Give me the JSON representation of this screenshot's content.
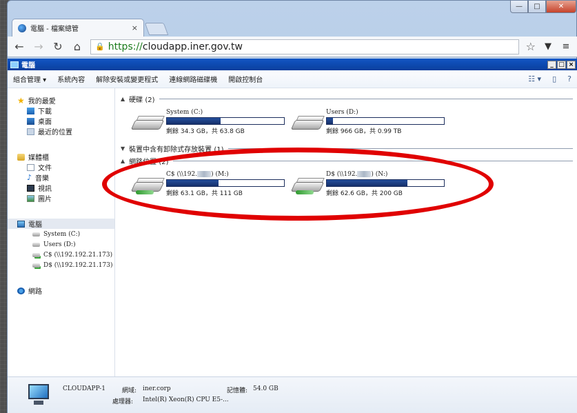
{
  "browser": {
    "tab_title": "電腦 - 檔案總管",
    "tab_close": "×",
    "url_scheme": "https://",
    "url_host": "cloudapp.iner.gov.tw",
    "window_controls": {
      "minimize": "—",
      "maximize": "□",
      "close": "✕"
    }
  },
  "explorer": {
    "title": "電腦",
    "window_controls": {
      "minimize": "_",
      "maximize": "□",
      "close": "×"
    },
    "commands": [
      {
        "label": "組合管理 ▾"
      },
      {
        "label": "系統內容"
      },
      {
        "label": "解除安裝或變更程式"
      },
      {
        "label": "連線網路磁碟機"
      },
      {
        "label": "開啟控制台"
      }
    ],
    "nav": {
      "favorites": {
        "label": "我的最愛",
        "items": [
          "下載",
          "桌面",
          "最近的位置"
        ]
      },
      "libraries": {
        "label": "媒體櫃",
        "items": [
          "文件",
          "音樂",
          "視訊",
          "圖片"
        ]
      },
      "computer": {
        "label": "電腦",
        "items": [
          "System (C:)",
          "Users (D:)",
          "C$ (\\\\192.192.21.173)",
          "D$ (\\\\192.192.21.173)"
        ]
      },
      "network": {
        "label": "網路"
      }
    },
    "groups": {
      "hdd": {
        "label": "硬碟 (2)"
      },
      "removable": {
        "label": "裝置中含有卸除式存放裝置 (1)"
      },
      "network": {
        "label": "網路位置 (2)"
      }
    },
    "drives": {
      "system_c": {
        "name": "System (C:)",
        "free": "剩餘 34.3 GB，共 63.8 GB",
        "used_fraction": 0.46
      },
      "users_d": {
        "name": "Users (D:)",
        "free": "剩餘 966 GB，共 0.99 TB",
        "used_fraction": 0.05
      },
      "net_c": {
        "name_prefix": "C$ (\\\\192.",
        "name_suffix": ") (M:)",
        "free": "剩餘 63.1 GB，共 111 GB",
        "used_fraction": 0.44
      },
      "net_d": {
        "name_prefix": "D$ (\\\\192.",
        "name_suffix": ") (N:)",
        "free": "剩餘 62.6 GB，共 200 GB",
        "used_fraction": 0.69
      }
    },
    "details": {
      "computer_name": "CLOUDAPP-1",
      "domain_label": "網域:",
      "domain_value": "iner.corp",
      "memory_label": "記憶體:",
      "memory_value": "54.0 GB",
      "cpu_label": "處理器:",
      "cpu_value": "Intel(R) Xeon(R) CPU E5-..."
    }
  },
  "colors": {
    "annotation": "#e00000",
    "title_bar": "#0a3f9d",
    "usage_bar": "#16306b"
  }
}
